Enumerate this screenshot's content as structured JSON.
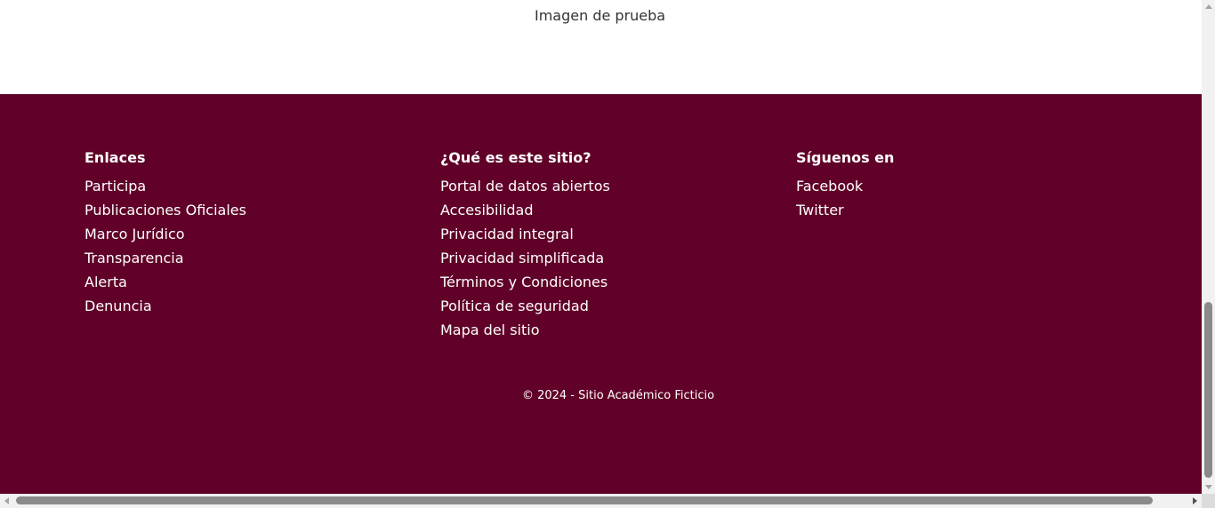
{
  "image": {
    "alt_text": "Imagen de prueba"
  },
  "colors": {
    "footer_background": "#610028",
    "footer_text": "#ffffff",
    "page_background": "#ffffff"
  },
  "footer": {
    "columns": [
      {
        "heading": "Enlaces",
        "links": [
          "Participa",
          "Publicaciones Oficiales",
          "Marco Jurídico",
          "Transparencia",
          "Alerta",
          "Denuncia"
        ]
      },
      {
        "heading": "¿Qué es este sitio?",
        "links": [
          "Portal de datos abiertos",
          "Accesibilidad",
          "Privacidad integral",
          "Privacidad simplificada",
          "Términos y Condiciones",
          "Política de seguridad",
          "Mapa del sitio"
        ]
      },
      {
        "heading": "Síguenos en",
        "links": [
          "Facebook",
          "Twitter"
        ]
      }
    ],
    "copyright": "© 2024 - Sitio Académico Ficticio"
  },
  "scrollbars": {
    "vertical_position_fraction": 0.98,
    "horizontal_position_fraction": 0.0
  }
}
